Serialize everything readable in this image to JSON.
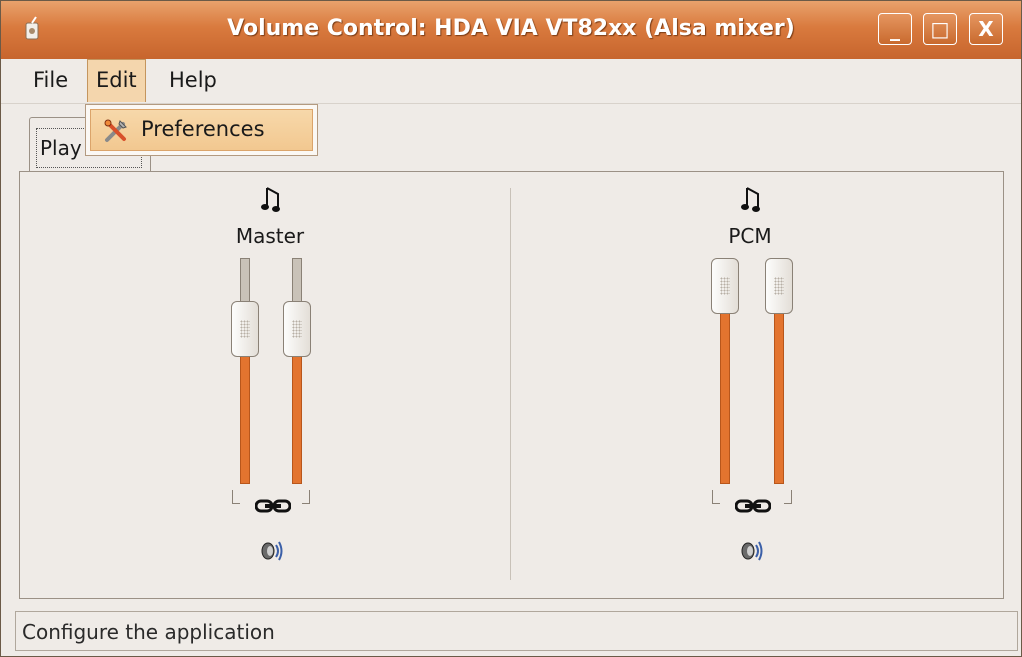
{
  "window": {
    "title": "Volume Control: HDA VIA VT82xx (Alsa mixer)",
    "buttons": {
      "minimize": "_",
      "maximize": "□",
      "close": "X"
    }
  },
  "menubar": {
    "file": "File",
    "edit": "Edit",
    "help": "Help"
  },
  "edit_menu": {
    "items": [
      {
        "label": "Preferences",
        "icon": "preferences-tools-icon"
      }
    ]
  },
  "tabs": [
    {
      "label": "Play",
      "active": true
    }
  ],
  "channels": [
    {
      "name": "Master",
      "left_level": 0.75,
      "right_level": 0.75,
      "locked": true,
      "muted": false
    },
    {
      "name": "PCM",
      "left_level": 1.0,
      "right_level": 1.0,
      "locked": true,
      "muted": false
    }
  ],
  "statusbar": {
    "text": "Configure the application"
  },
  "colors": {
    "accent": "#d97a3e",
    "slider_fill": "#e3742f",
    "menu_highlight": "#f4d6ad"
  }
}
